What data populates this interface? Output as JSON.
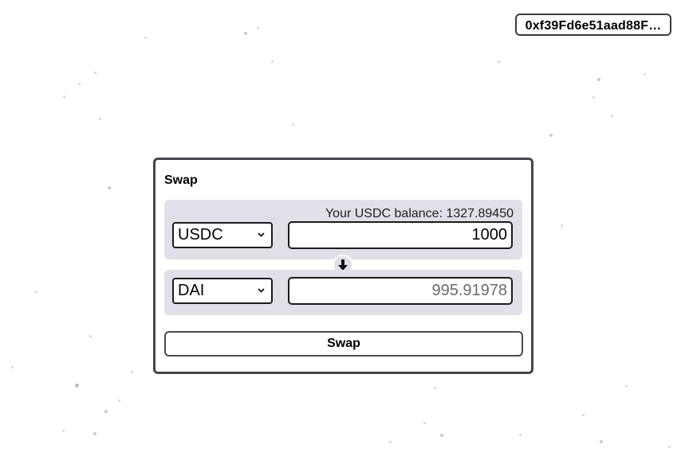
{
  "wallet": {
    "address": "0xf39Fd6e51aad88F…"
  },
  "swap": {
    "title": "Swap",
    "from": {
      "balance_text": "Your USDC balance: 1327.89450",
      "token": "USDC",
      "amount": "1000"
    },
    "to": {
      "token": "DAI",
      "amount": "995.91978"
    },
    "button_label": "Swap"
  },
  "icons": {
    "flip": "arrow-down-icon",
    "select_caret": "chevron-down-icon"
  }
}
